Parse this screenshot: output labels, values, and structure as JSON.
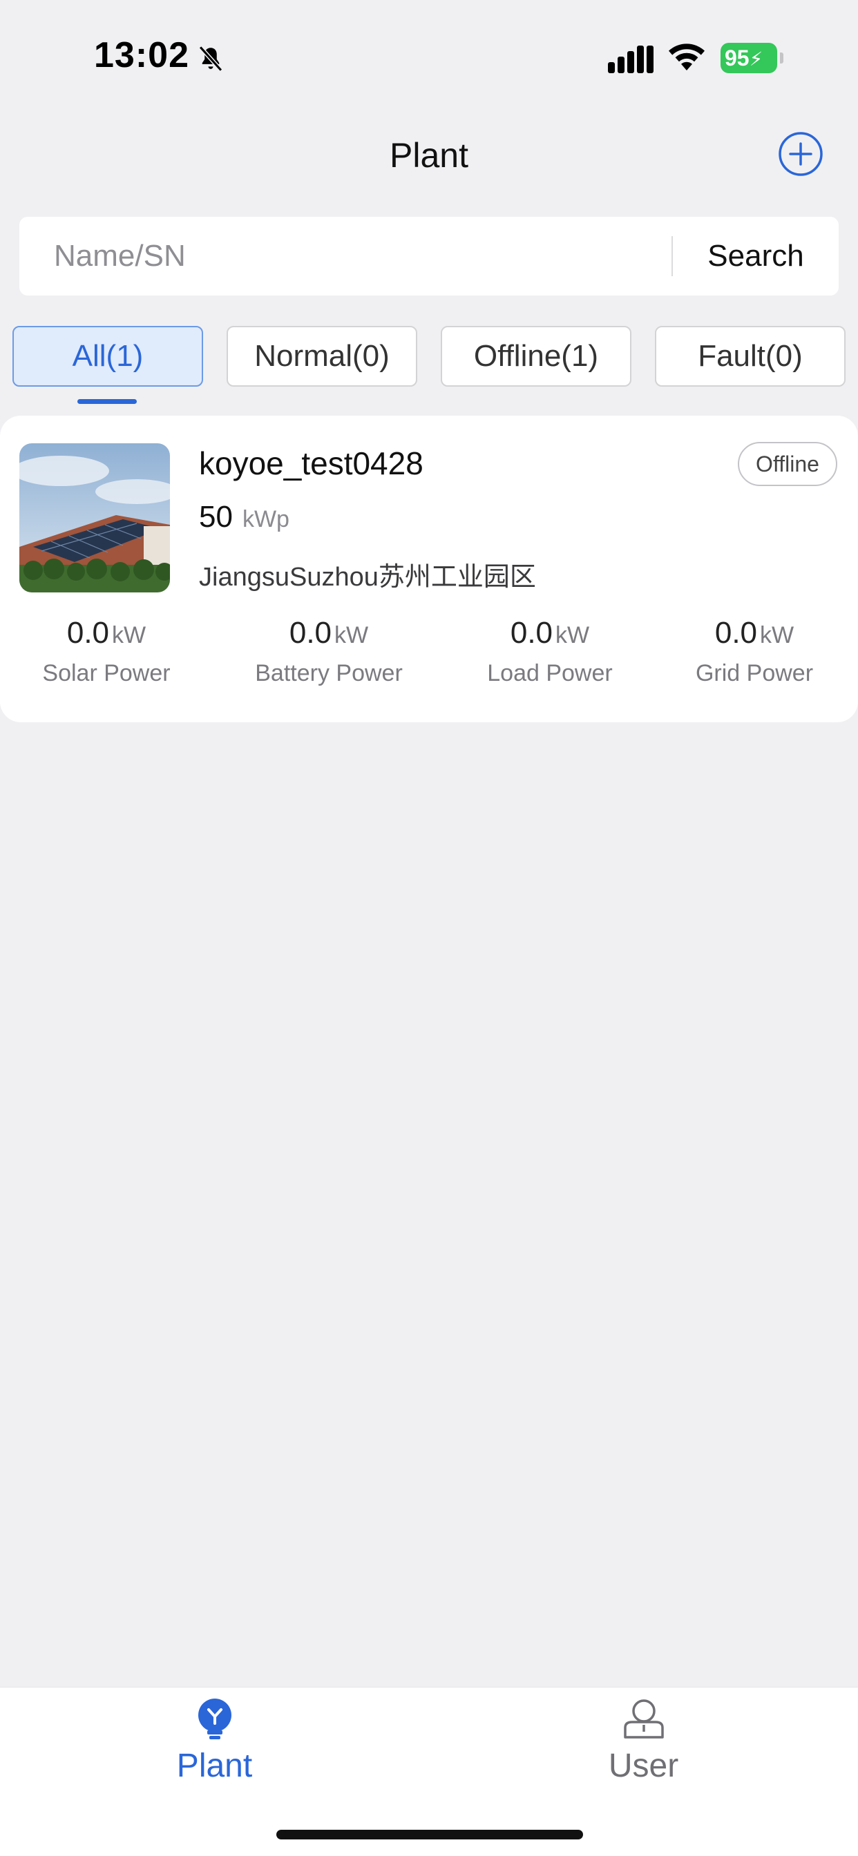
{
  "status_bar": {
    "time": "13:02",
    "battery": "95",
    "icons": [
      "bell-slash-icon",
      "cellular-signal-icon",
      "wifi-icon",
      "battery-charging-icon"
    ]
  },
  "header": {
    "title": "Plant",
    "add_icon": "plus-circle-icon"
  },
  "search": {
    "placeholder": "Name/SN",
    "value": "",
    "button_label": "Search"
  },
  "tabs": [
    {
      "label": "All(1)",
      "active": true
    },
    {
      "label": "Normal(0)",
      "active": false
    },
    {
      "label": "Offline(1)",
      "active": false
    },
    {
      "label": "Fault(0)",
      "active": false
    }
  ],
  "plants": [
    {
      "name": "koyoe_test0428",
      "status": "Offline",
      "capacity_value": "50",
      "capacity_unit": "kWp",
      "location": "JiangsuSuzhou苏州工业园区",
      "metrics": [
        {
          "value": "0.0",
          "unit": "kW",
          "label": "Solar Power"
        },
        {
          "value": "0.0",
          "unit": "kW",
          "label": "Battery Power"
        },
        {
          "value": "0.0",
          "unit": "kW",
          "label": "Load Power"
        },
        {
          "value": "0.0",
          "unit": "kW",
          "label": "Grid Power"
        }
      ]
    }
  ],
  "bottom_nav": [
    {
      "label": "Plant",
      "icon": "plant-bulb-icon",
      "active": true
    },
    {
      "label": "User",
      "icon": "user-icon",
      "active": false
    }
  ],
  "colors": {
    "accent": "#2a66d8",
    "background": "#f0f0f3",
    "battery": "#34c759"
  }
}
